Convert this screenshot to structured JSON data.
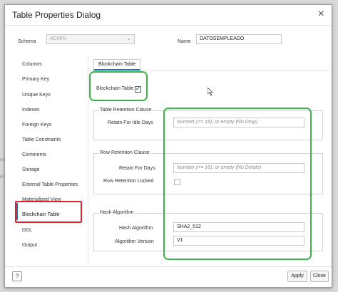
{
  "dialog": {
    "title": "Table Properties Dialog"
  },
  "header": {
    "schema_label": "Schema",
    "schema_value": "ADMIN",
    "name_label": "Name",
    "name_value": "DATOSEMPLEADO"
  },
  "sidebar": {
    "items": [
      {
        "label": "Columns"
      },
      {
        "label": "Primary Key"
      },
      {
        "label": "Unique Keys"
      },
      {
        "label": "Indexes"
      },
      {
        "label": "Foreign Keys"
      },
      {
        "label": "Table Constraints"
      },
      {
        "label": "Comments"
      },
      {
        "label": "Storage"
      },
      {
        "label": "External Table Properties"
      },
      {
        "label": "Materialized View"
      },
      {
        "label": "Blockchain Table"
      },
      {
        "label": "DDL"
      },
      {
        "label": "Output"
      }
    ],
    "active": "Blockchain Table"
  },
  "tab": {
    "label": "Blockchain Table"
  },
  "blockchain": {
    "checkbox_label": "Blockchain Table",
    "checked": true
  },
  "table_retention": {
    "title": "Table Retention Clause",
    "idle_days_label": "Retain For Idle Days",
    "idle_days_placeholder": "Number (>= 16), or empty (No Drop)"
  },
  "row_retention": {
    "title": "Row Retention Clause",
    "days_label": "Retain For Days",
    "days_placeholder": "Number (>= 16), or empty (No Delete)",
    "locked_label": "Row Retention Locked"
  },
  "hash": {
    "title": "Hash Algorithm",
    "algorithm_label": "Hash Algorithm",
    "algorithm_value": "SHA2_512",
    "version_label": "Algorithm Version",
    "version_value": "V1"
  },
  "footer": {
    "help_label": "?",
    "apply_label": "Apply",
    "close_label": "Close"
  },
  "background": {
    "left_text_1": "nt O",
    "left_text_2": "ne"
  },
  "colors": {
    "accent": "#1e73be",
    "highlight_green": "#3cb44a",
    "highlight_red": "#d9232e"
  },
  "icons": {
    "close": "close-icon",
    "dropdown": "chevron-down-icon",
    "check": "checkmark-icon",
    "help": "help-icon",
    "cursor": "mouse-cursor-icon"
  }
}
